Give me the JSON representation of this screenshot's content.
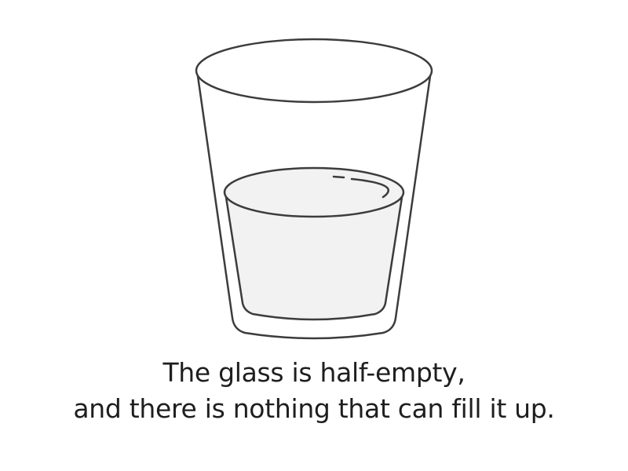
{
  "caption": {
    "line1": "The glass is half-empty,",
    "line2": "and there is nothing that can fill it up."
  },
  "illustration": {
    "icon": "half-empty-glass-icon",
    "fill_level": 0.5,
    "colors": {
      "outline": "#3c3c3c",
      "water": "#f2f2f2",
      "background": "#ffffff"
    }
  }
}
